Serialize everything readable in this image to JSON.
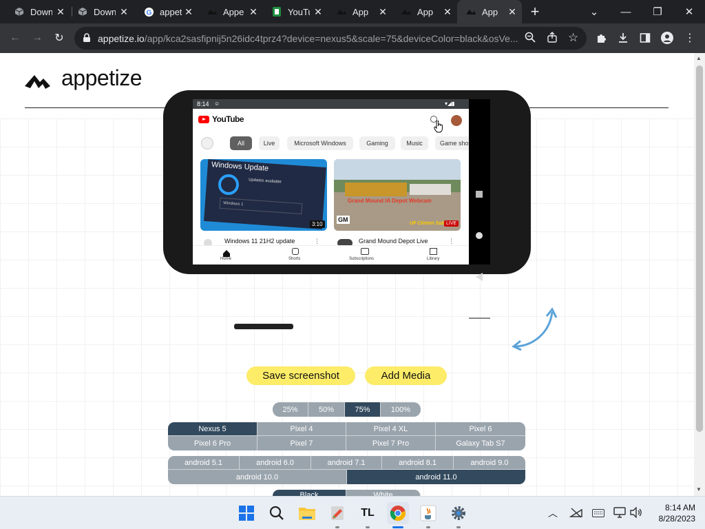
{
  "tabs": [
    {
      "title": "Down"
    },
    {
      "title": "Down"
    },
    {
      "title": "appet"
    },
    {
      "title": "Appe"
    },
    {
      "title": "YouTu"
    },
    {
      "title": "App"
    },
    {
      "title": "App"
    },
    {
      "title": "App"
    }
  ],
  "address": {
    "host": "appetize.io",
    "path": "/app/kca2sasfipnij5n26idc4tprz4?device=nexus5&scale=75&deviceColor=black&osVe..."
  },
  "brand": {
    "name": "appetize"
  },
  "device": {
    "time": "8:14",
    "youtube_logo": "YouTube",
    "chips": [
      "All",
      "Live",
      "Microsoft Windows",
      "Gaming",
      "Music",
      "Game sho"
    ],
    "thumb1_text": "Windows Update",
    "thumb1_sub": "Updates available",
    "thumb1_field": "Windows 1",
    "thumb1_duration": "3:10",
    "thumb2_overlay": "Grand Mound IA Depot Webcam",
    "thumb2_logo": "GM",
    "thumb2_live": "LIVE",
    "thumb2_brand": "UP Clinton Sub",
    "video1_title": "Windows 11 21H2 update",
    "video2_title": "Grand Mound Depot Live",
    "bottom_nav": [
      "Home",
      "Shorts",
      "Subscriptions",
      "Library"
    ]
  },
  "actions": {
    "save": "Save screenshot",
    "media": "Add Media"
  },
  "scales": [
    {
      "label": "25%"
    },
    {
      "label": "50%"
    },
    {
      "label": "75%",
      "selected": true
    },
    {
      "label": "100%"
    }
  ],
  "devices": [
    {
      "label": "Nexus 5",
      "selected": true
    },
    {
      "label": "Pixel 4"
    },
    {
      "label": "Pixel 4 XL"
    },
    {
      "label": "Pixel 6"
    },
    {
      "label": "Pixel 6 Pro"
    },
    {
      "label": "Pixel 7"
    },
    {
      "label": "Pixel 7 Pro"
    },
    {
      "label": "Galaxy Tab S7"
    }
  ],
  "versions": [
    {
      "label": "android 5.1"
    },
    {
      "label": "android 6.0"
    },
    {
      "label": "android 7.1"
    },
    {
      "label": "android 8.1"
    },
    {
      "label": "android 9.0"
    },
    {
      "label": "android 10.0"
    },
    {
      "label": "android 11.0",
      "selected": true
    }
  ],
  "colors_partial": [
    {
      "label": "Black",
      "selected": true
    },
    {
      "label": "White"
    }
  ],
  "clock": {
    "time": "8:14 AM",
    "date": "8/28/2023"
  },
  "theme": {
    "accent": "#fcec68",
    "selected": "#334a5e",
    "segment": "#9aa4ad",
    "chrome_dark": "#202124",
    "chrome_mid": "#35363a"
  }
}
